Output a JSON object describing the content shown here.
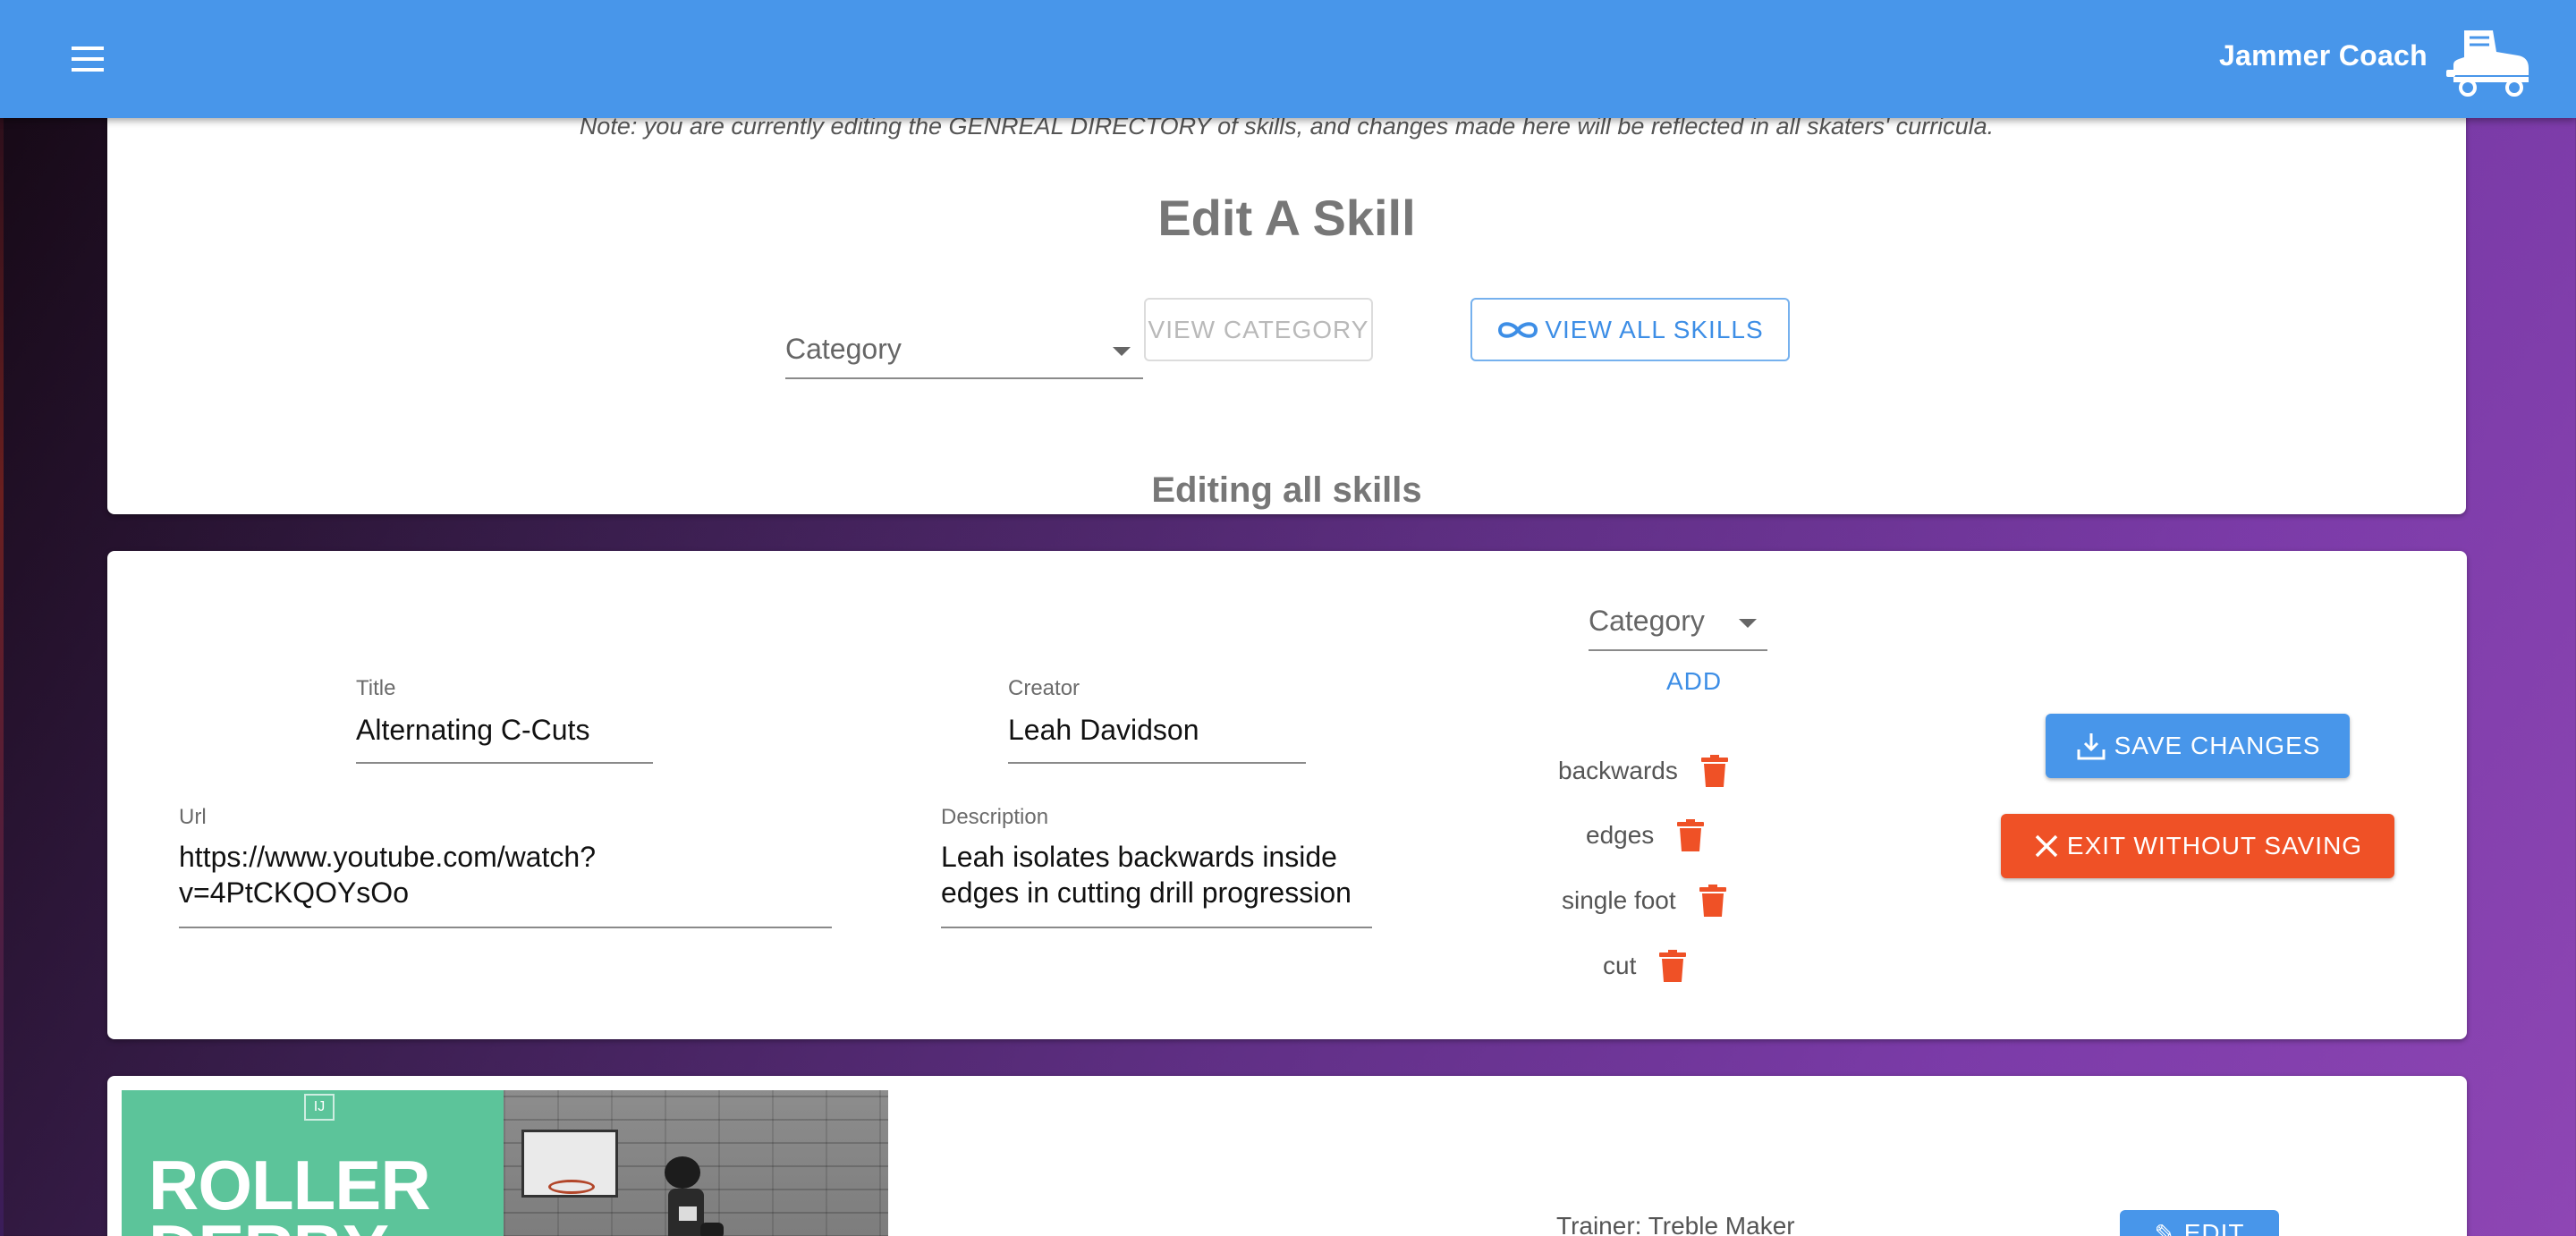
{
  "app": {
    "title": "Jammer Coach",
    "colors": {
      "primary": "#4896ea",
      "danger": "#ef5126"
    }
  },
  "header": {
    "note": "Note: you are currently editing the GENREAL DIRECTORY of skills, and changes made here will be reflected in all skaters' curricula.",
    "title": "Edit A Skill",
    "category_placeholder": "Category",
    "view_category_label": "VIEW CATEGORY",
    "view_all_label": "VIEW ALL SKILLS",
    "editing_status": "Editing all skills"
  },
  "form": {
    "title_label": "Title",
    "title_value": "Alternating C-Cuts",
    "creator_label": "Creator",
    "creator_value": "Leah Davidson",
    "url_label": "Url",
    "url_value_line1": "https://www.youtube.com/watch?",
    "url_value_line2": "v=4PtCKQOYsOo",
    "description_label": "Description",
    "description_line1": "Leah isolates backwards inside",
    "description_line2": "edges in cutting drill progression",
    "category_placeholder": "Category",
    "add_label": "ADD",
    "tags": [
      "backwards",
      "edges",
      "single foot",
      "cut"
    ],
    "save_label": "SAVE CHANGES",
    "exit_label": "EXIT WITHOUT SAVING"
  },
  "preview": {
    "thumbnail_text_line1": "ROLLER",
    "thumbnail_text_line2": "DERBY",
    "trainer": "Trainer: Treble Maker",
    "edit_label": "EDIT"
  },
  "icons": {
    "menu": "menu-icon",
    "logo": "roller-skate-icon",
    "infinity": "infinity-icon",
    "trash": "trash-icon",
    "download": "download-icon",
    "close": "close-icon",
    "edit": "pencil-icon"
  }
}
